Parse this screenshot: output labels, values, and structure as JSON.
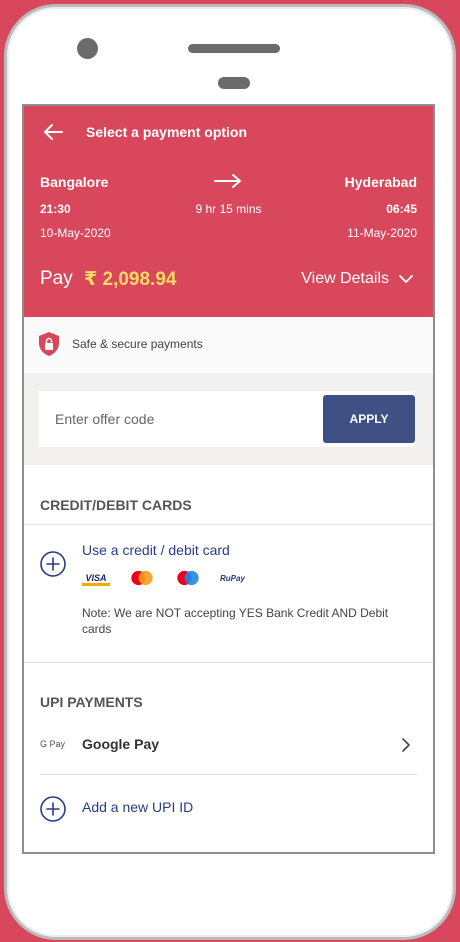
{
  "header": {
    "title": "Select a payment option",
    "from_city": "Bangalore",
    "to_city": "Hyderabad",
    "dep_time": "21:30",
    "arr_time": "06:45",
    "duration": "9 hr 15 mins",
    "dep_date": "10-May-2020",
    "arr_date": "11-May-2020",
    "pay_label": "Pay",
    "pay_amount": "₹ 2,098.94",
    "view_details": "View Details"
  },
  "secure": {
    "text": "Safe & secure payments"
  },
  "offer": {
    "placeholder": "Enter offer code",
    "apply_label": "APPLY"
  },
  "cards": {
    "section_title": "CREDIT/DEBIT CARDS",
    "option_label": "Use a credit / debit card",
    "logos": [
      "VISA",
      "RuPay"
    ],
    "note": "Note: We are NOT accepting YES Bank Credit AND Debit cards"
  },
  "upi": {
    "section_title": "UPI PAYMENTS",
    "gpay_logo": "G Pay",
    "gpay_label": "Google Pay",
    "add_label": "Add a new UPI ID"
  },
  "colors": {
    "brand": "#d8475b",
    "accent_button": "#3f5184",
    "link": "#2a3a8a",
    "amount": "#ffd966"
  },
  "icons": [
    "back-arrow-icon",
    "right-arrow-icon",
    "chevron-down-icon",
    "shield-icon",
    "plus-circle-icon",
    "chevron-right-icon"
  ]
}
